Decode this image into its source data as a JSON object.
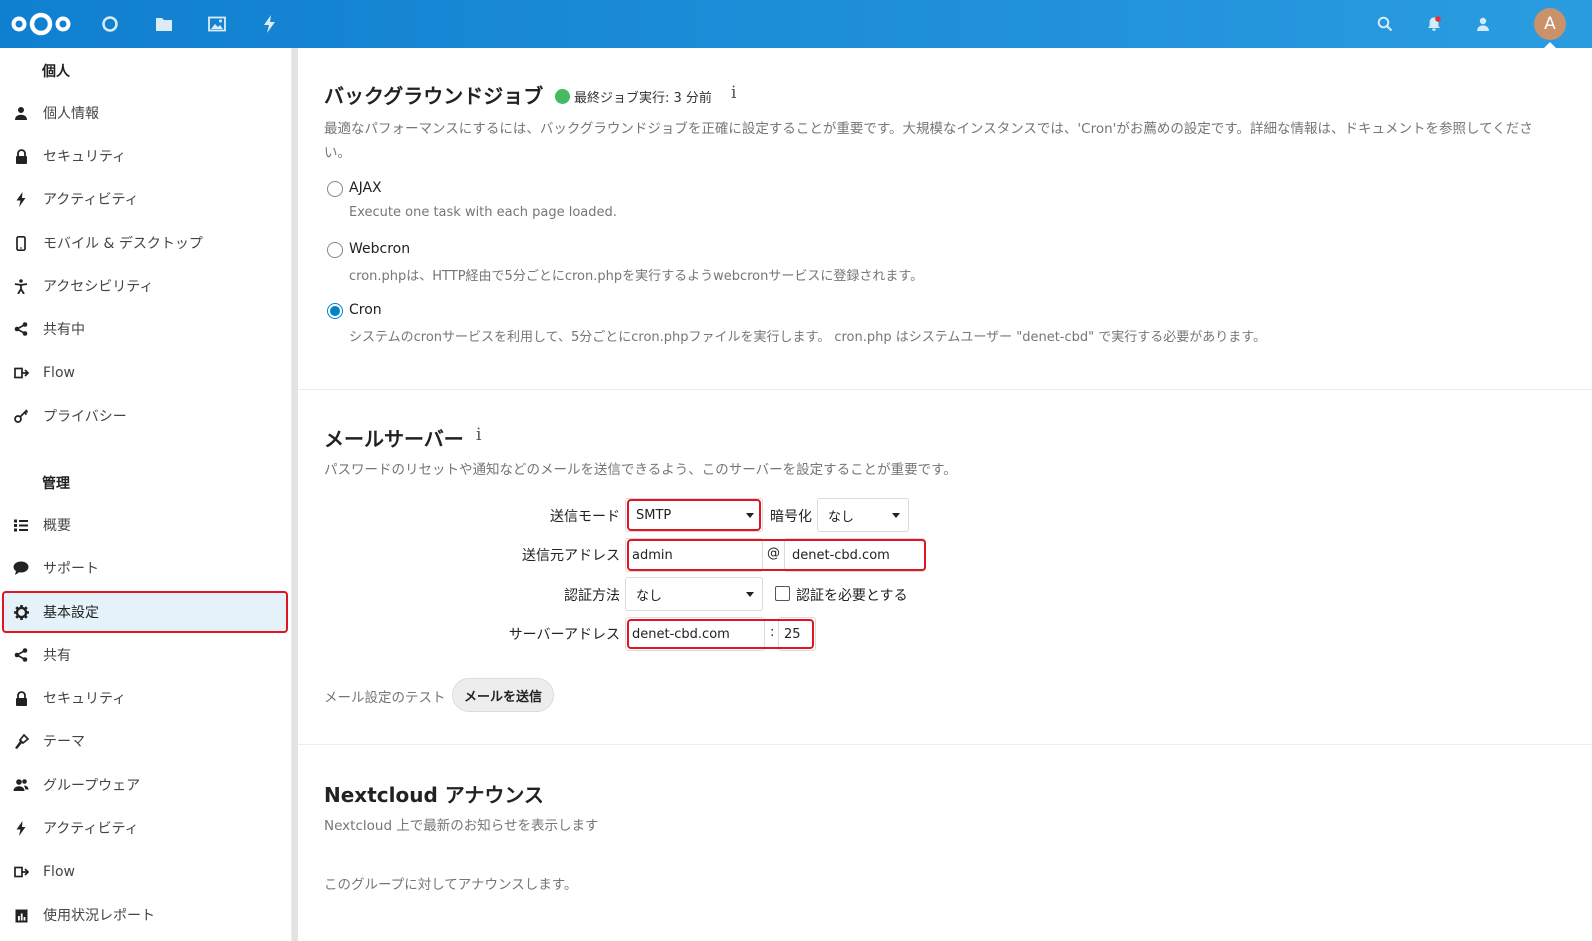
{
  "header": {
    "apps": [
      {
        "name": "dashboard-icon"
      },
      {
        "name": "files-icon"
      },
      {
        "name": "photos-icon"
      },
      {
        "name": "activity-icon"
      }
    ],
    "right_icons": [
      {
        "name": "search-icon"
      },
      {
        "name": "notifications-icon"
      },
      {
        "name": "contacts-icon"
      }
    ],
    "avatar_letter": "A"
  },
  "sidebar": {
    "personal_caption": "個人",
    "personal_items": [
      {
        "label": "個人情報",
        "icon": "user-icon"
      },
      {
        "label": "セキュリティ",
        "icon": "lock-icon"
      },
      {
        "label": "アクティビティ",
        "icon": "activity-icon"
      },
      {
        "label": "モバイル & デスクトップ",
        "icon": "phone-icon"
      },
      {
        "label": "アクセシビリティ",
        "icon": "accessibility-icon"
      },
      {
        "label": "共有中",
        "icon": "share-icon"
      },
      {
        "label": "Flow",
        "icon": "flow-icon"
      },
      {
        "label": "プライバシー",
        "icon": "key-icon"
      }
    ],
    "admin_caption": "管理",
    "admin_items": [
      {
        "label": "概要",
        "icon": "list-icon"
      },
      {
        "label": "サポート",
        "icon": "chat-icon"
      },
      {
        "label": "基本設定",
        "icon": "gear-icon",
        "active": true
      },
      {
        "label": "共有",
        "icon": "share-icon"
      },
      {
        "label": "セキュリティ",
        "icon": "lock-icon"
      },
      {
        "label": "テーマ",
        "icon": "theming-icon"
      },
      {
        "label": "グループウェア",
        "icon": "groupware-icon"
      },
      {
        "label": "アクティビティ",
        "icon": "activity-icon"
      },
      {
        "label": "Flow",
        "icon": "flow-icon"
      },
      {
        "label": "使用状況レポート",
        "icon": "report-icon"
      }
    ]
  },
  "background_jobs": {
    "title": "バックグラウンドジョブ",
    "status": "最終ジョブ実行: 3 分前",
    "status_color": "#46ba61",
    "description": "最適なパフォーマンスにするには、バックグラウンドジョブを正確に設定することが重要です。大規模なインスタンスでは、'Cron'がお薦めの設定です。詳細な情報は、ドキュメントを参照してください。",
    "options": [
      {
        "label": "AJAX",
        "desc": "Execute one task with each page loaded.",
        "checked": false
      },
      {
        "label": "Webcron",
        "desc": "cron.phpは、HTTP経由で5分ごとにcron.phpを実行するようwebcronサービスに登録されます。",
        "checked": false
      },
      {
        "label": "Cron",
        "desc": "システムのcronサービスを利用して、5分ごとにcron.phpファイルを実行します。 cron.php はシステムユーザー \"denet-cbd\" で実行する必要があります。",
        "checked": true
      }
    ]
  },
  "mail_server": {
    "title": "メールサーバー",
    "description": "パスワードのリセットや通知などのメールを送信できるよう、このサーバーを設定することが重要です。",
    "send_mode_label": "送信モード",
    "send_mode_value": "SMTP",
    "encryption_label": "暗号化",
    "encryption_value": "なし",
    "from_label": "送信元アドレス",
    "from_user": "admin",
    "at_sign": "@",
    "from_domain": "denet-cbd.com",
    "auth_label": "認証方法",
    "auth_value": "なし",
    "auth_required_label": "認証を必要とする",
    "server_label": "サーバーアドレス",
    "server_host": "denet-cbd.com",
    "colon": ":",
    "server_port": "25",
    "test_label": "メール設定のテスト",
    "send_button": "メールを送信"
  },
  "announcements": {
    "title": "Nextcloud アナウンス",
    "description": "Nextcloud 上で最新のお知らせを表示します",
    "group_text": "このグループに対してアナウンスします。"
  }
}
